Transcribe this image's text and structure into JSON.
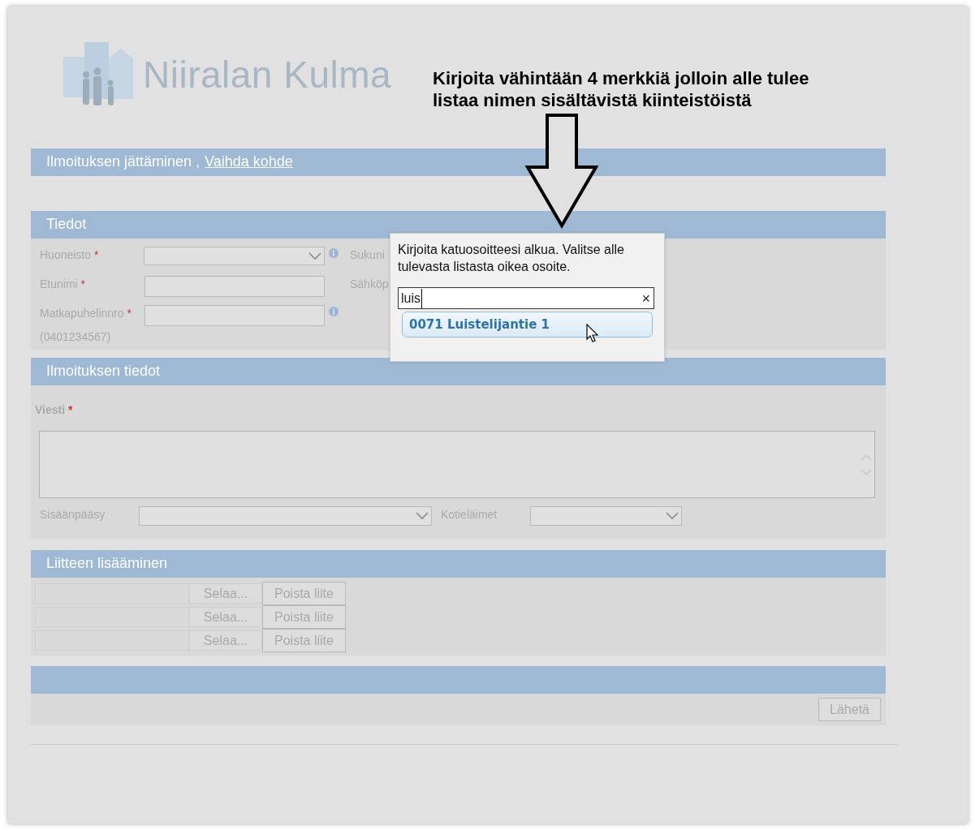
{
  "logo": {
    "text": "Niiralan Kulma"
  },
  "annotation": {
    "text": "Kirjoita vähintään 4 merkkiä jolloin alle tulee listaa nimen sisältävistä kiinteistöistä"
  },
  "header_bar": {
    "title": "Ilmoituksen jättäminen ,",
    "link": "Vaihda kohde"
  },
  "tiedot": {
    "title": "Tiedot",
    "fields": [
      {
        "kind": "select",
        "label": "Huoneisto",
        "mark": "*",
        "info": true,
        "side_label": "Sukuni"
      },
      {
        "kind": "text",
        "label": "Etunimi",
        "mark": "*",
        "info": false,
        "side_label": "Sähköp"
      },
      {
        "kind": "text",
        "label": "Matkapuhelinnro",
        "mark": "*",
        "hint": "(0401234567)",
        "info": true
      }
    ]
  },
  "ilmoitus": {
    "title": "Ilmoituksen tiedot",
    "message_label": "Viesti",
    "mark": "*",
    "selects": [
      {
        "label": "Sisäänpääsy"
      },
      {
        "label": "Kotieläimet"
      }
    ]
  },
  "liitteet": {
    "title": "Liitteen lisääminen",
    "rows": [
      {
        "browse": "Selaa...",
        "remove": "Poista liite"
      },
      {
        "browse": "Selaa...",
        "remove": "Poista liite"
      },
      {
        "browse": "Selaa...",
        "remove": "Poista liite"
      }
    ]
  },
  "footer": {
    "submit": "Lähetä"
  },
  "dialog": {
    "instructions": "Kirjoita katuosoitteesi alkua. Valitse alle tulevasta listasta oikea osoite.",
    "value": "luis",
    "clear": "×",
    "suggestions": [
      {
        "text": "0071 Luistelijantie 1",
        "selected": true
      }
    ]
  }
}
